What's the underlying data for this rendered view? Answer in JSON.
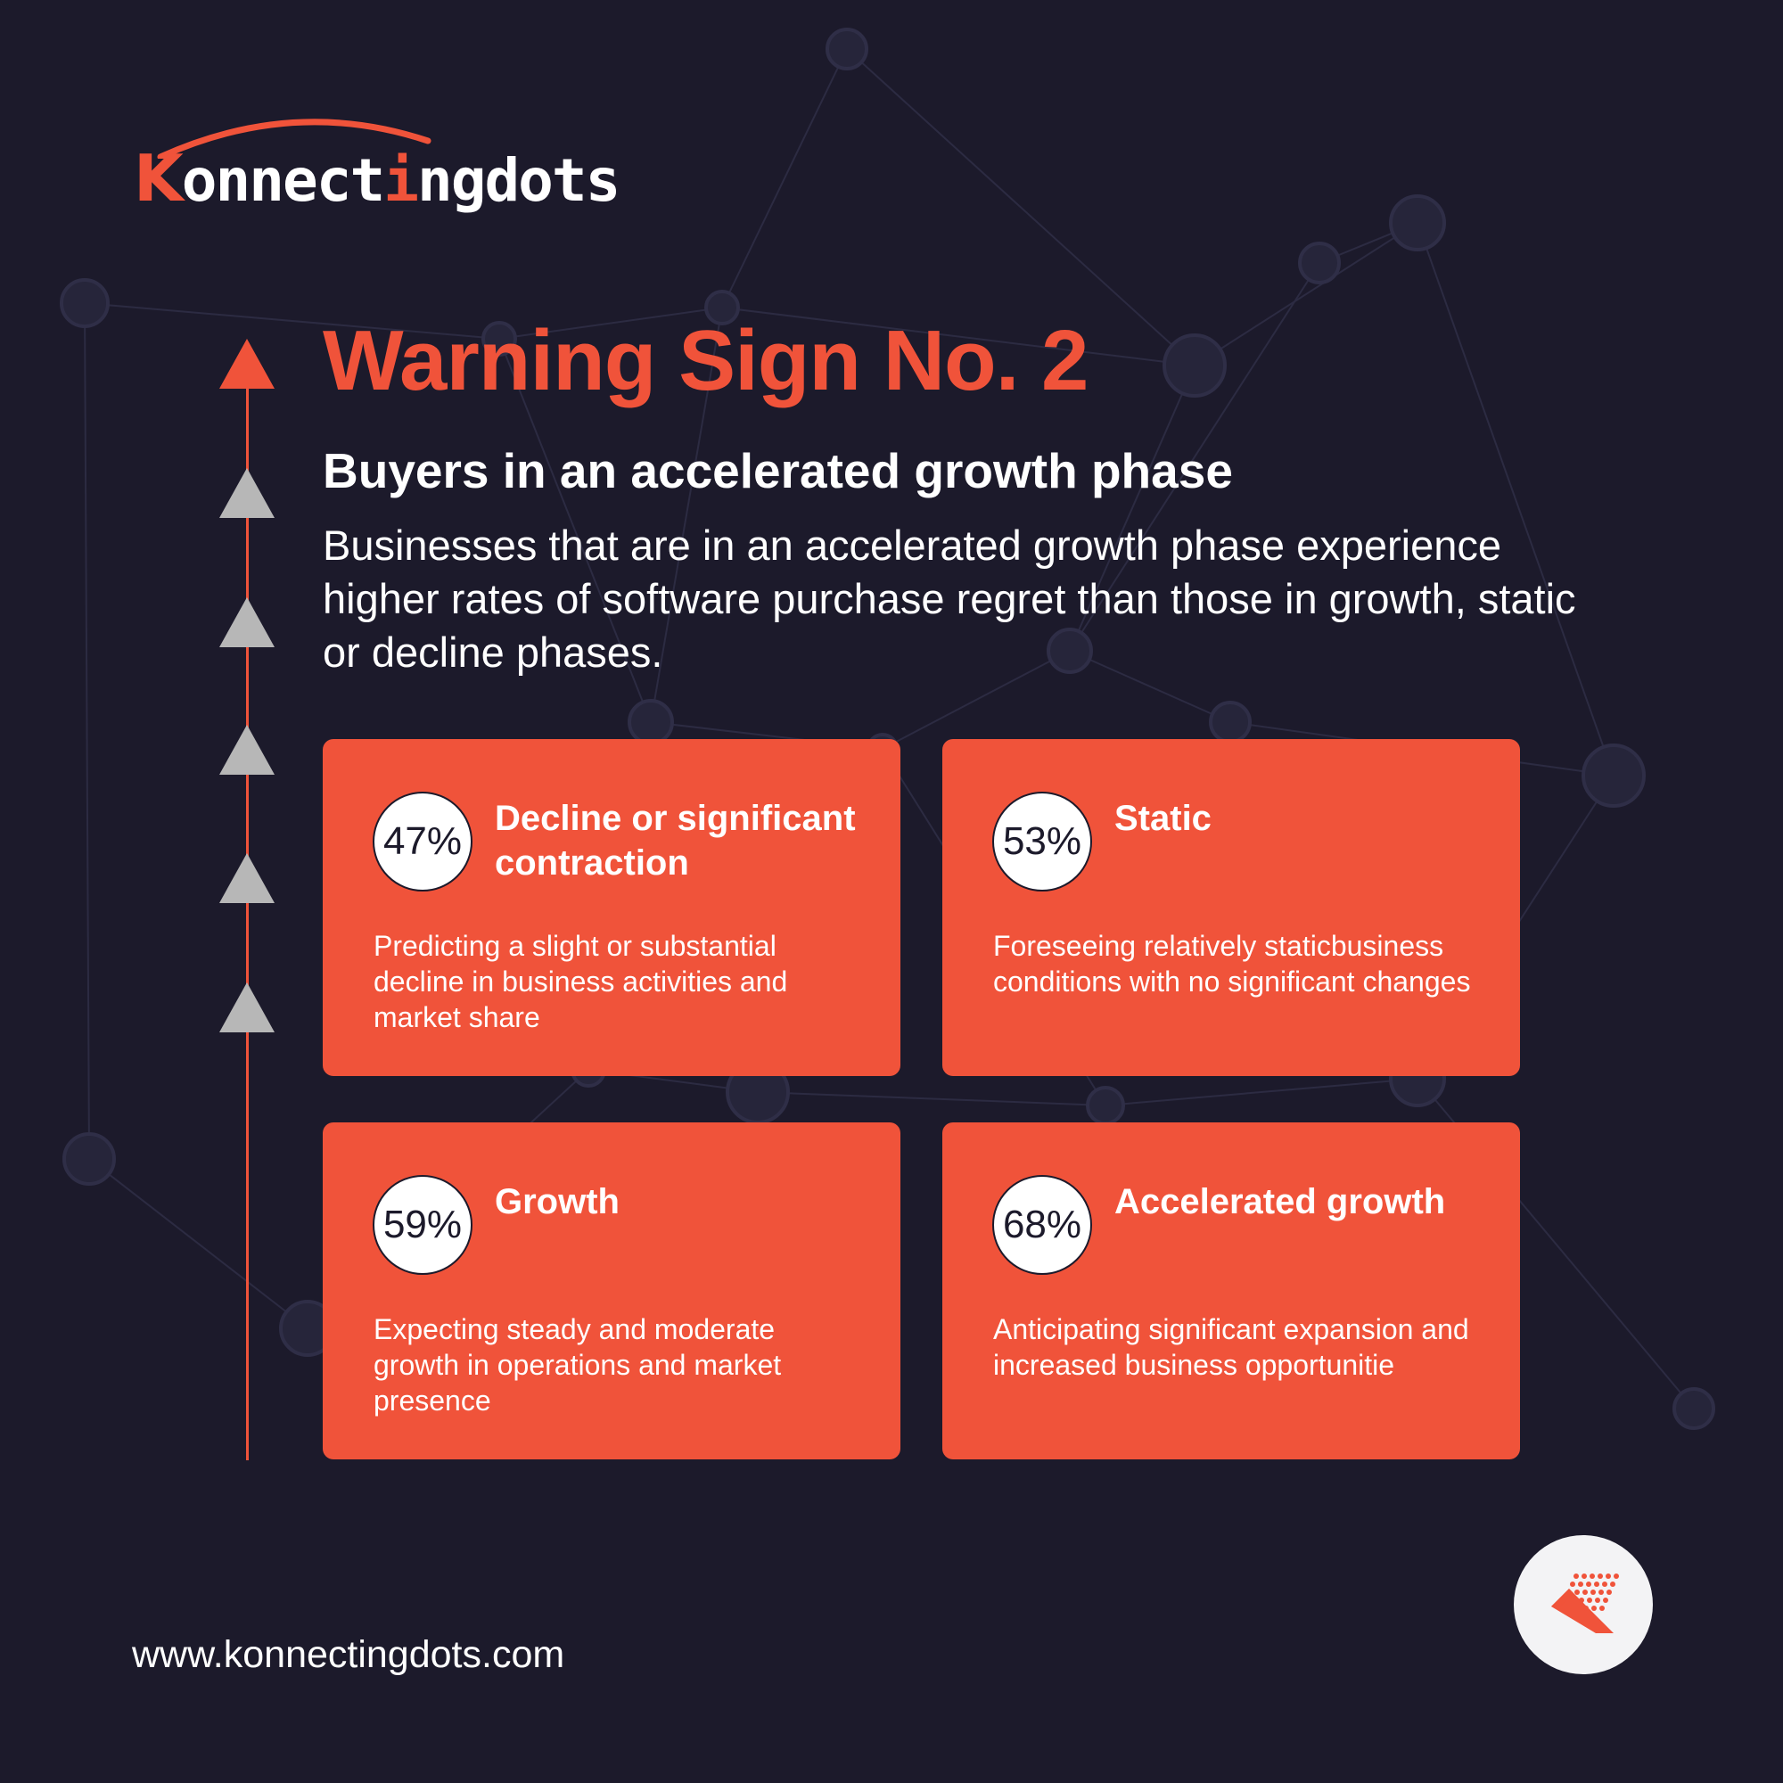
{
  "brand": {
    "logo_k": "K",
    "logo_part1": "onnect",
    "logo_i": "i",
    "logo_part2": "ngdots",
    "accent_color": "#f0533a",
    "background_color": "#1c1a2b",
    "website": "www.konnectingdots.com",
    "badge_icon": "konnectingdots-k-icon"
  },
  "header": {
    "title": "Warning Sign No. 2",
    "subtitle": "Buyers in an accelerated growth phase",
    "intro": "Businesses that are in an accelerated growth phase experience higher rates of software purchase regret than those in growth, static or decline phases."
  },
  "timeline": {
    "marker_icon": "triangle-up-icon",
    "active_index": 0,
    "marker_count": 6
  },
  "cards": [
    {
      "percent": "47%",
      "title": "Decline or significant contraction",
      "description": "Predicting a slight or substantial decline in business activities and market share"
    },
    {
      "percent": "53%",
      "title": "Static",
      "description": "Foreseeing relatively staticbusiness conditions with no significant changes"
    },
    {
      "percent": "59%",
      "title": "Growth",
      "description": "Expecting steady and moderate growth in operations and market presence"
    },
    {
      "percent": "68%",
      "title": "Accelerated growth",
      "description": "Anticipating significant expansion and increased business opportunitie"
    }
  ]
}
